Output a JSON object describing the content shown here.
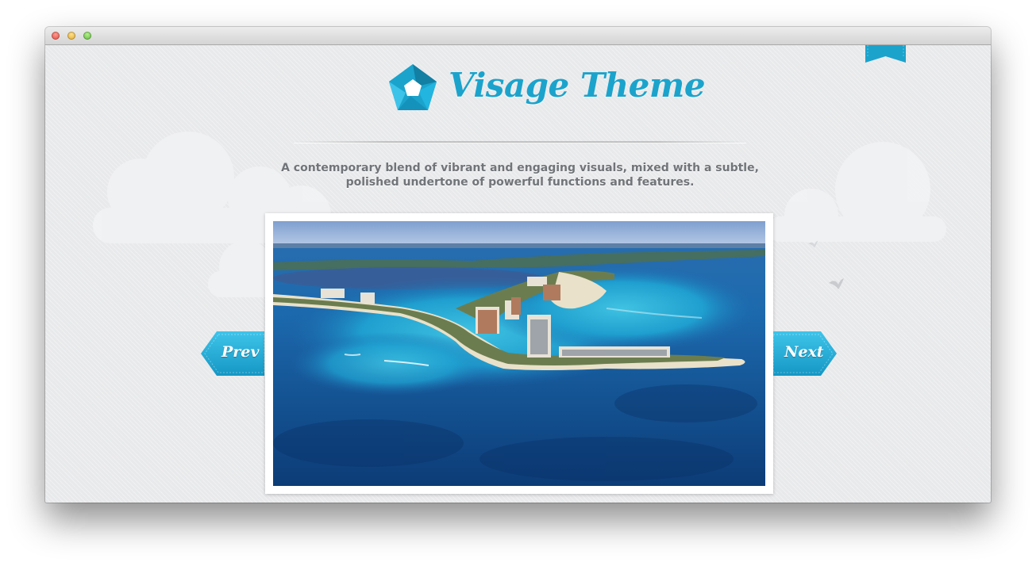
{
  "window": {
    "controls": [
      "close",
      "minimize",
      "maximize"
    ]
  },
  "header": {
    "logo_icon": "camera-aperture-icon",
    "title": "Visage Theme",
    "tagline_line1": "A contemporary blend of vibrant and engaging visuals, mixed with a subtle,",
    "tagline_line2": "polished undertone of powerful functions and features."
  },
  "slider": {
    "prev_label": "Prev",
    "next_label": "Next",
    "image_subject": "aerial view of a resort peninsula surrounded by turquoise sea"
  },
  "colors": {
    "accent": "#1ba3cc",
    "background": "#e8e9eb",
    "text": "#717478"
  }
}
